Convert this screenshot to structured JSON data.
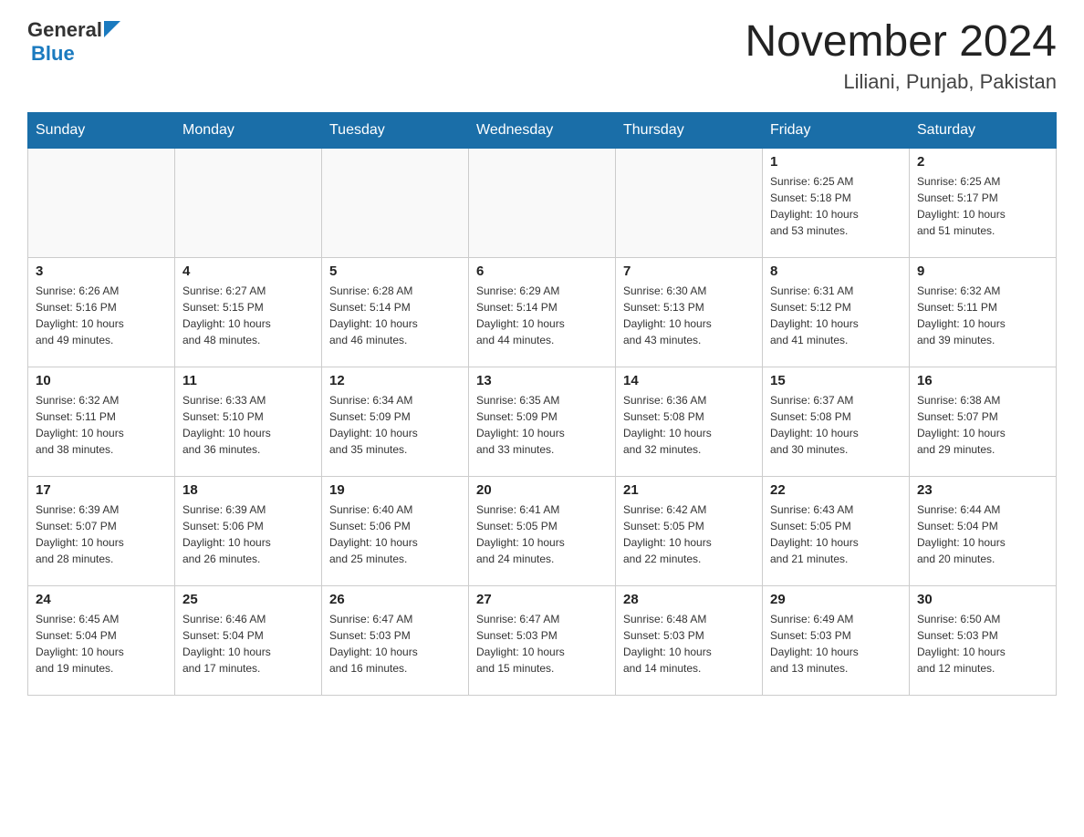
{
  "header": {
    "logo": {
      "text_general": "General",
      "text_blue": "Blue"
    },
    "title": "November 2024",
    "location": "Liliani, Punjab, Pakistan"
  },
  "calendar": {
    "days_of_week": [
      "Sunday",
      "Monday",
      "Tuesday",
      "Wednesday",
      "Thursday",
      "Friday",
      "Saturday"
    ],
    "weeks": [
      [
        {
          "day": "",
          "info": ""
        },
        {
          "day": "",
          "info": ""
        },
        {
          "day": "",
          "info": ""
        },
        {
          "day": "",
          "info": ""
        },
        {
          "day": "",
          "info": ""
        },
        {
          "day": "1",
          "info": "Sunrise: 6:25 AM\nSunset: 5:18 PM\nDaylight: 10 hours\nand 53 minutes."
        },
        {
          "day": "2",
          "info": "Sunrise: 6:25 AM\nSunset: 5:17 PM\nDaylight: 10 hours\nand 51 minutes."
        }
      ],
      [
        {
          "day": "3",
          "info": "Sunrise: 6:26 AM\nSunset: 5:16 PM\nDaylight: 10 hours\nand 49 minutes."
        },
        {
          "day": "4",
          "info": "Sunrise: 6:27 AM\nSunset: 5:15 PM\nDaylight: 10 hours\nand 48 minutes."
        },
        {
          "day": "5",
          "info": "Sunrise: 6:28 AM\nSunset: 5:14 PM\nDaylight: 10 hours\nand 46 minutes."
        },
        {
          "day": "6",
          "info": "Sunrise: 6:29 AM\nSunset: 5:14 PM\nDaylight: 10 hours\nand 44 minutes."
        },
        {
          "day": "7",
          "info": "Sunrise: 6:30 AM\nSunset: 5:13 PM\nDaylight: 10 hours\nand 43 minutes."
        },
        {
          "day": "8",
          "info": "Sunrise: 6:31 AM\nSunset: 5:12 PM\nDaylight: 10 hours\nand 41 minutes."
        },
        {
          "day": "9",
          "info": "Sunrise: 6:32 AM\nSunset: 5:11 PM\nDaylight: 10 hours\nand 39 minutes."
        }
      ],
      [
        {
          "day": "10",
          "info": "Sunrise: 6:32 AM\nSunset: 5:11 PM\nDaylight: 10 hours\nand 38 minutes."
        },
        {
          "day": "11",
          "info": "Sunrise: 6:33 AM\nSunset: 5:10 PM\nDaylight: 10 hours\nand 36 minutes."
        },
        {
          "day": "12",
          "info": "Sunrise: 6:34 AM\nSunset: 5:09 PM\nDaylight: 10 hours\nand 35 minutes."
        },
        {
          "day": "13",
          "info": "Sunrise: 6:35 AM\nSunset: 5:09 PM\nDaylight: 10 hours\nand 33 minutes."
        },
        {
          "day": "14",
          "info": "Sunrise: 6:36 AM\nSunset: 5:08 PM\nDaylight: 10 hours\nand 32 minutes."
        },
        {
          "day": "15",
          "info": "Sunrise: 6:37 AM\nSunset: 5:08 PM\nDaylight: 10 hours\nand 30 minutes."
        },
        {
          "day": "16",
          "info": "Sunrise: 6:38 AM\nSunset: 5:07 PM\nDaylight: 10 hours\nand 29 minutes."
        }
      ],
      [
        {
          "day": "17",
          "info": "Sunrise: 6:39 AM\nSunset: 5:07 PM\nDaylight: 10 hours\nand 28 minutes."
        },
        {
          "day": "18",
          "info": "Sunrise: 6:39 AM\nSunset: 5:06 PM\nDaylight: 10 hours\nand 26 minutes."
        },
        {
          "day": "19",
          "info": "Sunrise: 6:40 AM\nSunset: 5:06 PM\nDaylight: 10 hours\nand 25 minutes."
        },
        {
          "day": "20",
          "info": "Sunrise: 6:41 AM\nSunset: 5:05 PM\nDaylight: 10 hours\nand 24 minutes."
        },
        {
          "day": "21",
          "info": "Sunrise: 6:42 AM\nSunset: 5:05 PM\nDaylight: 10 hours\nand 22 minutes."
        },
        {
          "day": "22",
          "info": "Sunrise: 6:43 AM\nSunset: 5:05 PM\nDaylight: 10 hours\nand 21 minutes."
        },
        {
          "day": "23",
          "info": "Sunrise: 6:44 AM\nSunset: 5:04 PM\nDaylight: 10 hours\nand 20 minutes."
        }
      ],
      [
        {
          "day": "24",
          "info": "Sunrise: 6:45 AM\nSunset: 5:04 PM\nDaylight: 10 hours\nand 19 minutes."
        },
        {
          "day": "25",
          "info": "Sunrise: 6:46 AM\nSunset: 5:04 PM\nDaylight: 10 hours\nand 17 minutes."
        },
        {
          "day": "26",
          "info": "Sunrise: 6:47 AM\nSunset: 5:03 PM\nDaylight: 10 hours\nand 16 minutes."
        },
        {
          "day": "27",
          "info": "Sunrise: 6:47 AM\nSunset: 5:03 PM\nDaylight: 10 hours\nand 15 minutes."
        },
        {
          "day": "28",
          "info": "Sunrise: 6:48 AM\nSunset: 5:03 PM\nDaylight: 10 hours\nand 14 minutes."
        },
        {
          "day": "29",
          "info": "Sunrise: 6:49 AM\nSunset: 5:03 PM\nDaylight: 10 hours\nand 13 minutes."
        },
        {
          "day": "30",
          "info": "Sunrise: 6:50 AM\nSunset: 5:03 PM\nDaylight: 10 hours\nand 12 minutes."
        }
      ]
    ]
  }
}
